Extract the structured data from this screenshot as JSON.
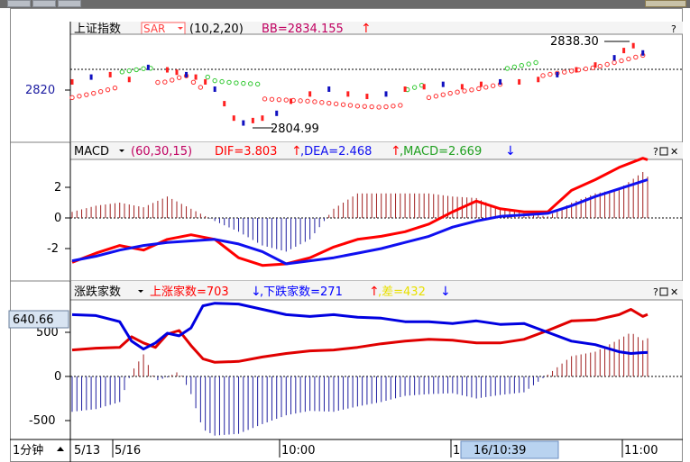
{
  "chart_data": [
    {
      "type": "line",
      "title": "上证指数",
      "overlay": {
        "label": "SAR",
        "params": "(10,2,20)",
        "bb_label": "BB=2834.155",
        "bb_arrow": "↑"
      },
      "ytick": "2820",
      "annotations": {
        "high": "2838.30",
        "low": "2804.99"
      },
      "ylim": [
        2798,
        2842
      ],
      "series": [
        {
          "name": "BB",
          "color": "#ff2020",
          "x": [
            0,
            10,
            20,
            30,
            40,
            44,
            48,
            52,
            56,
            60,
            64,
            70,
            80,
            90,
            100,
            110,
            120,
            130,
            140,
            150,
            160,
            170,
            180,
            190,
            200,
            210,
            220,
            230,
            240,
            242
          ],
          "values": [
            2818.5,
            2820.5,
            2823.0,
            2824.5,
            2825.0,
            2826.5,
            2827.5,
            2824.0,
            2821.5,
            2819.5,
            2819.0,
            2818.5,
            2818.0,
            2817.5,
            2817.0,
            2816.0,
            2815.0,
            2814.5,
            2815.5,
            2818.5,
            2820.5,
            2822.0,
            2824.0,
            2826.0,
            2828.0,
            2829.5,
            2831.0,
            2833.5,
            2836.0,
            2838.3
          ]
        }
      ]
    },
    {
      "type": "line",
      "title": "MACD",
      "legend": {
        "params": "(60,30,15)",
        "dif": "DIF=3.803",
        "dea": ",DEA=2.468",
        "macd": ",MACD=2.669",
        "dif_arrow": "↑",
        "dea_arrow": "↑",
        "macd_arrow": "↓"
      },
      "yticks": [
        "2",
        "0",
        "-2"
      ],
      "ylim": [
        -4,
        4
      ],
      "series": [
        {
          "name": "DIF",
          "color": "#ff0000",
          "x": [
            0,
            10,
            20,
            30,
            40,
            50,
            60,
            70,
            80,
            90,
            100,
            110,
            120,
            130,
            140,
            150,
            160,
            170,
            180,
            190,
            200,
            210,
            220,
            230,
            240,
            242
          ],
          "values": [
            -2.9,
            -2.3,
            -1.8,
            -2.1,
            -1.4,
            -1.1,
            -1.4,
            -2.6,
            -3.1,
            -3.0,
            -2.6,
            -1.9,
            -1.4,
            -1.2,
            -0.9,
            -0.4,
            0.4,
            1.1,
            0.6,
            0.4,
            0.4,
            1.8,
            2.5,
            3.3,
            3.9,
            3.8
          ]
        },
        {
          "name": "DEA",
          "color": "#1010f0",
          "x": [
            0,
            10,
            20,
            30,
            40,
            50,
            60,
            70,
            80,
            90,
            100,
            110,
            120,
            130,
            140,
            150,
            160,
            170,
            180,
            190,
            200,
            210,
            220,
            230,
            240,
            242
          ],
          "values": [
            -2.8,
            -2.5,
            -2.1,
            -1.8,
            -1.6,
            -1.5,
            -1.4,
            -1.7,
            -2.2,
            -3.0,
            -2.8,
            -2.6,
            -2.3,
            -2.0,
            -1.6,
            -1.2,
            -0.6,
            -0.2,
            0.1,
            0.2,
            0.3,
            0.8,
            1.4,
            1.9,
            2.4,
            2.5
          ]
        }
      ],
      "histogram": {
        "x": [
          0,
          10,
          20,
          30,
          40,
          50,
          60,
          70,
          80,
          90,
          100,
          110,
          120,
          130,
          140,
          150,
          160,
          170,
          180,
          190,
          200,
          210,
          220,
          230,
          240,
          242
        ],
        "values": [
          0.4,
          0.8,
          1.0,
          0.7,
          1.4,
          0.6,
          -0.2,
          -0.9,
          -1.8,
          -2.2,
          -1.4,
          0.6,
          1.6,
          1.6,
          1.6,
          1.6,
          1.4,
          1.3,
          0.6,
          0.3,
          0.1,
          1.0,
          1.6,
          1.9,
          3.0,
          2.7
        ]
      }
    },
    {
      "type": "line",
      "title": "涨跌家数",
      "legend": {
        "up": "上涨家数=703",
        "down": ",下跌家数=271",
        "diff": ",差=432",
        "up_arrow": "↓",
        "down_arrow": "↑",
        "diff_arrow": "↓"
      },
      "yticks": [
        "500",
        "0",
        "-500"
      ],
      "current_value": "640.66",
      "ylim": [
        -700,
        850
      ],
      "series": [
        {
          "name": "上涨家数",
          "color": "#e00000",
          "x": [
            0,
            10,
            20,
            25,
            30,
            35,
            40,
            45,
            50,
            55,
            60,
            70,
            80,
            90,
            100,
            110,
            120,
            130,
            140,
            150,
            160,
            170,
            180,
            190,
            200,
            210,
            220,
            230,
            235,
            240,
            242
          ],
          "values": [
            300,
            320,
            330,
            450,
            380,
            330,
            480,
            520,
            350,
            200,
            160,
            170,
            220,
            260,
            290,
            300,
            330,
            370,
            400,
            420,
            410,
            380,
            380,
            420,
            520,
            630,
            640,
            700,
            760,
            680,
            703
          ]
        },
        {
          "name": "下跌家数",
          "color": "#0000e0",
          "x": [
            0,
            10,
            20,
            25,
            30,
            35,
            40,
            45,
            50,
            55,
            60,
            70,
            80,
            90,
            100,
            110,
            120,
            130,
            140,
            150,
            160,
            170,
            180,
            190,
            200,
            210,
            220,
            230,
            235,
            240,
            242
          ],
          "values": [
            700,
            690,
            620,
            400,
            310,
            380,
            490,
            460,
            550,
            800,
            830,
            820,
            760,
            700,
            680,
            700,
            670,
            660,
            620,
            620,
            600,
            630,
            590,
            600,
            500,
            400,
            360,
            280,
            260,
            270,
            271
          ]
        }
      ],
      "histogram": {
        "x": [
          0,
          10,
          20,
          25,
          30,
          35,
          40,
          45,
          50,
          55,
          60,
          70,
          80,
          90,
          100,
          110,
          120,
          130,
          140,
          150,
          160,
          170,
          180,
          190,
          200,
          210,
          220,
          230,
          235,
          240,
          242
        ],
        "values": [
          -400,
          -370,
          -290,
          50,
          250,
          -50,
          -10,
          60,
          -200,
          -600,
          -670,
          -650,
          -540,
          -440,
          -390,
          -400,
          -340,
          -290,
          -220,
          -200,
          -190,
          -250,
          -210,
          -180,
          20,
          230,
          280,
          420,
          500,
          410,
          432
        ]
      }
    }
  ],
  "xaxis": {
    "period_label": "1分钟",
    "labels": [
      "5/13",
      "5/16",
      "10:00",
      "1",
      "11:00"
    ],
    "cursor_label": "16/10:39"
  },
  "colors": {
    "axis": "#000000",
    "title": "#000000",
    "up": "#ff0000",
    "down": "#0000ff"
  }
}
